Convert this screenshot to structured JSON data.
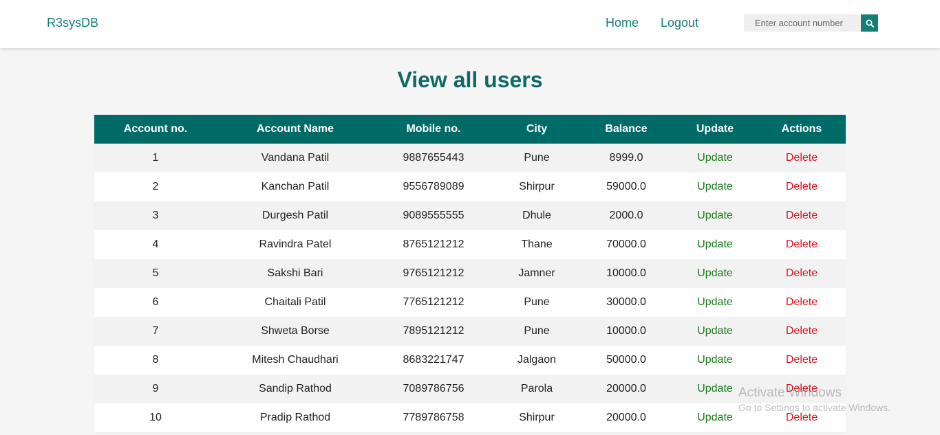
{
  "navbar": {
    "brand": "R3sysDB",
    "links": {
      "home": "Home",
      "logout": "Logout"
    },
    "search": {
      "placeholder": "Enter account number",
      "icon": "search-icon"
    }
  },
  "page": {
    "title": "View all users"
  },
  "table": {
    "columns": [
      "Account no.",
      "Account Name",
      "Mobile no.",
      "City",
      "Balance",
      "Update",
      "Actions"
    ],
    "rows": [
      {
        "account_no": "1",
        "name": "Vandana Patil",
        "mobile": "9887655443",
        "city": "Pune",
        "balance": "8999.0",
        "update": "Update",
        "action": "Delete"
      },
      {
        "account_no": "2",
        "name": "Kanchan Patil",
        "mobile": "9556789089",
        "city": "Shirpur",
        "balance": "59000.0",
        "update": "Update",
        "action": "Delete"
      },
      {
        "account_no": "3",
        "name": "Durgesh Patil",
        "mobile": "9089555555",
        "city": "Dhule",
        "balance": "2000.0",
        "update": "Update",
        "action": "Delete"
      },
      {
        "account_no": "4",
        "name": "Ravindra Patel",
        "mobile": "8765121212",
        "city": "Thane",
        "balance": "70000.0",
        "update": "Update",
        "action": "Delete"
      },
      {
        "account_no": "5",
        "name": "Sakshi Bari",
        "mobile": "9765121212",
        "city": "Jamner",
        "balance": "10000.0",
        "update": "Update",
        "action": "Delete"
      },
      {
        "account_no": "6",
        "name": "Chaitali Patil",
        "mobile": "7765121212",
        "city": "Pune",
        "balance": "30000.0",
        "update": "Update",
        "action": "Delete"
      },
      {
        "account_no": "7",
        "name": "Shweta Borse",
        "mobile": "7895121212",
        "city": "Pune",
        "balance": "10000.0",
        "update": "Update",
        "action": "Delete"
      },
      {
        "account_no": "8",
        "name": "Mitesh Chaudhari",
        "mobile": "8683221747",
        "city": "Jalgaon",
        "balance": "50000.0",
        "update": "Update",
        "action": "Delete"
      },
      {
        "account_no": "9",
        "name": "Sandip Rathod",
        "mobile": "7089786756",
        "city": "Parola",
        "balance": "20000.0",
        "update": "Update",
        "action": "Delete"
      },
      {
        "account_no": "10",
        "name": "Pradip Rathod",
        "mobile": "7789786758",
        "city": "Shirpur",
        "balance": "20000.0",
        "update": "Update",
        "action": "Delete"
      }
    ]
  },
  "watermark": {
    "title": "Activate Windows",
    "subtitle": "Go to Settings to activate Windows."
  },
  "colors": {
    "brand": "#167d78",
    "header_bg": "#006a66",
    "title": "#0f6a66",
    "update_link": "#1b7a1b",
    "delete_link": "#d3131c"
  }
}
